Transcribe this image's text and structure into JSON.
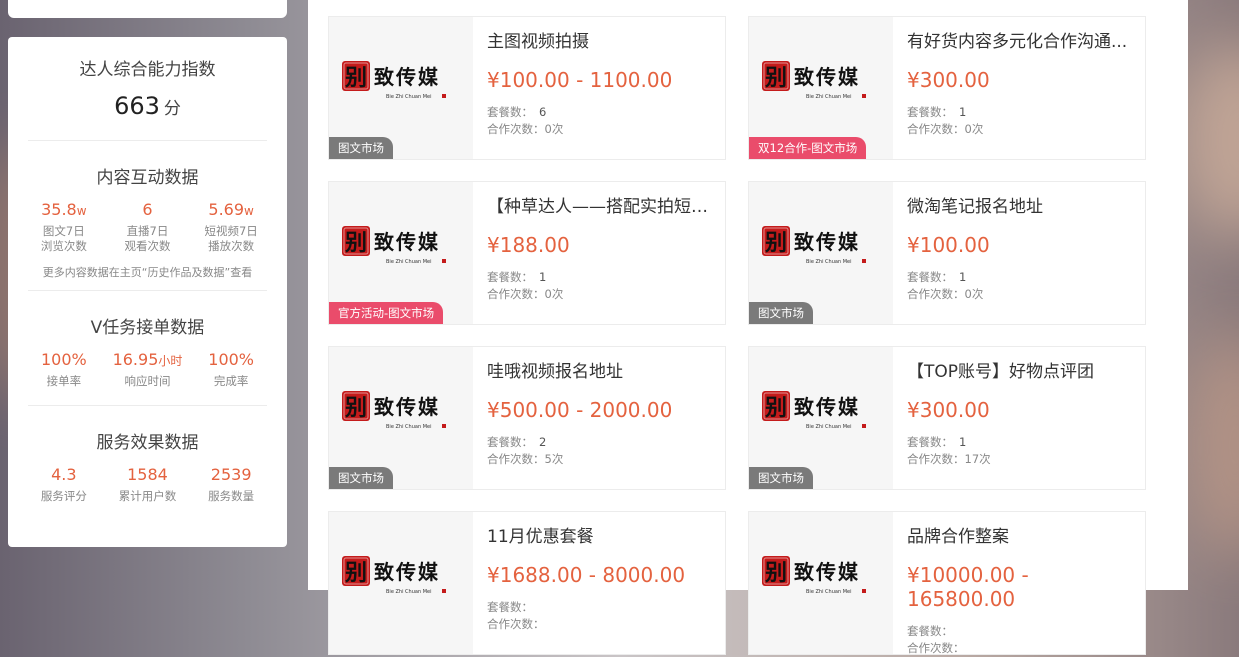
{
  "sidebar": {
    "ability": {
      "title": "达人综合能力指数",
      "score": "663",
      "unit": "分"
    },
    "content_interaction": {
      "title": "内容互动数据",
      "stats": [
        {
          "value": "35.8",
          "unit": "w",
          "label1": "图文7日",
          "label2": "浏览次数"
        },
        {
          "value": "6",
          "unit": "",
          "label1": "直播7日",
          "label2": "观看次数"
        },
        {
          "value": "5.69",
          "unit": "w",
          "label1": "短视频7日",
          "label2": "播放次数"
        }
      ],
      "note": "更多内容数据在主页“历史作品及数据”查看"
    },
    "v_task": {
      "title": "V任务接单数据",
      "stats": [
        {
          "value": "100%",
          "unit": "",
          "label": "接单率"
        },
        {
          "value": "16.95",
          "unit": "小时",
          "label": "响应时间"
        },
        {
          "value": "100%",
          "unit": "",
          "label": "完成率"
        }
      ]
    },
    "service": {
      "title": "服务效果数据",
      "stats": [
        {
          "value": "4.3",
          "label": "服务评分"
        },
        {
          "value": "1584",
          "label": "累计用户数"
        },
        {
          "value": "2539",
          "label": "服务数量"
        }
      ]
    }
  },
  "colors": {
    "accent": "#e4623f",
    "tag_gray": "#7a7a7a",
    "tag_pink": "#ea4c6b"
  },
  "cards": [
    {
      "title": "主图视频拍摄",
      "price": "¥100.00 - 1100.00",
      "packages_label": "套餐数：",
      "packages": "6",
      "coops_label": "合作次数：",
      "coops": "0次",
      "tag": "图文市场",
      "tag_style": "gray",
      "logo_brand": "别致传媒",
      "logo_sub": "Bie Zhi Chuan Mei"
    },
    {
      "title": "有好货内容多元化合作沟通...",
      "price": "¥300.00",
      "packages_label": "套餐数：",
      "packages": "1",
      "coops_label": "合作次数：",
      "coops": "0次",
      "tag": "双12合作-图文市场",
      "tag_style": "pink",
      "logo_brand": "别致传媒",
      "logo_sub": "Bie Zhi Chuan Mei"
    },
    {
      "title": "【种草达人——搭配实拍短图...",
      "price": "¥188.00",
      "packages_label": "套餐数：",
      "packages": "1",
      "coops_label": "合作次数：",
      "coops": "0次",
      "tag": "官方活动-图文市场",
      "tag_style": "pink",
      "logo_brand": "别致传媒",
      "logo_sub": "Bie Zhi Chuan Mei"
    },
    {
      "title": "微淘笔记报名地址",
      "price": "¥100.00",
      "packages_label": "套餐数：",
      "packages": "1",
      "coops_label": "合作次数：",
      "coops": "0次",
      "tag": "图文市场",
      "tag_style": "gray",
      "logo_brand": "别致传媒",
      "logo_sub": "Bie Zhi Chuan Mei"
    },
    {
      "title": "哇哦视频报名地址",
      "price": "¥500.00 - 2000.00",
      "packages_label": "套餐数：",
      "packages": "2",
      "coops_label": "合作次数：",
      "coops": "5次",
      "tag": "图文市场",
      "tag_style": "gray",
      "logo_brand": "别致传媒",
      "logo_sub": "Bie Zhi Chuan Mei"
    },
    {
      "title": "【TOP账号】好物点评团",
      "price": "¥300.00",
      "packages_label": "套餐数：",
      "packages": "1",
      "coops_label": "合作次数：",
      "coops": "17次",
      "tag": "图文市场",
      "tag_style": "gray",
      "logo_brand": "别致传媒",
      "logo_sub": "Bie Zhi Chuan Mei"
    },
    {
      "title": "11月优惠套餐",
      "price": "¥1688.00 - 8000.00",
      "packages_label": "套餐数：",
      "packages": "",
      "coops_label": "合作次数：",
      "coops": "",
      "tag": "",
      "tag_style": "gray",
      "logo_brand": "别致传媒",
      "logo_sub": "Bie Zhi Chuan Mei"
    },
    {
      "title": "品牌合作整案",
      "price": "¥10000.00 - 165800.00",
      "packages_label": "套餐数：",
      "packages": "",
      "coops_label": "合作次数：",
      "coops": "",
      "tag": "",
      "tag_style": "gray",
      "logo_brand": "别致传媒",
      "logo_sub": "Bie Zhi Chuan Mei"
    }
  ]
}
